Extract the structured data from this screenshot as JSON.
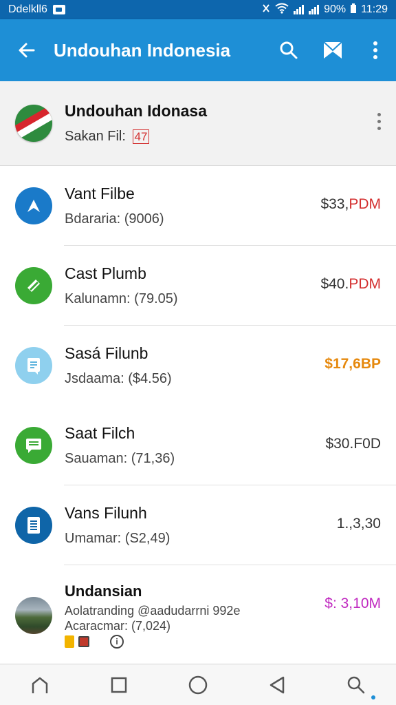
{
  "status_bar": {
    "carrier": "Ddelkll6",
    "battery": "90%",
    "time": "11:29"
  },
  "app_bar": {
    "title": "Undouhan Indonesia",
    "color": "#1e8fd6",
    "icons": [
      "back-arrow-icon",
      "search-icon",
      "bookmark-icon",
      "more-vert-icon"
    ]
  },
  "header": {
    "title": "Undouhan Idonasa",
    "subtitle": "Sakan Fil:",
    "count": "47"
  },
  "items": [
    {
      "icon": "compass-icon",
      "icon_bg": "#1a7ac9",
      "title": "Vant Filbe",
      "subtitle": "Bdararia: (9006)",
      "amount_main": "$33,",
      "amount_accent": "PDM"
    },
    {
      "icon": "edit-icon",
      "icon_bg": "#3aaa35",
      "title": "Cast Plumb",
      "subtitle": "Kalunamn: (79.05)",
      "amount_main": "$40.",
      "amount_accent": "PDM"
    },
    {
      "icon": "document-icon",
      "icon_bg": "#8fd0ee",
      "title": "Sasá Filunb",
      "subtitle": "Jsdaama: ($4.56)",
      "amount_main": "$17,6BP"
    },
    {
      "icon": "message-icon",
      "icon_bg": "#3aaa35",
      "title": "Saat Filch",
      "subtitle": "Sauaman: (71,36)",
      "amount_main": "$30.F0D"
    },
    {
      "icon": "file-icon",
      "icon_bg": "#0f65a8",
      "title": "Vans Filunh",
      "subtitle": "Umamar: (S2,49)",
      "amount_main": "1.,3,30"
    }
  ],
  "last_item": {
    "title": "Undansian",
    "line1": "Aolatranding @aadudarrni 992e",
    "line2": "Acaracmar: (7,024)",
    "amount": "$: 3,10M"
  },
  "nav": {
    "icons": [
      "home-icon",
      "recent-apps-icon",
      "circle-home-icon",
      "back-triangle-icon",
      "search-icon"
    ]
  }
}
